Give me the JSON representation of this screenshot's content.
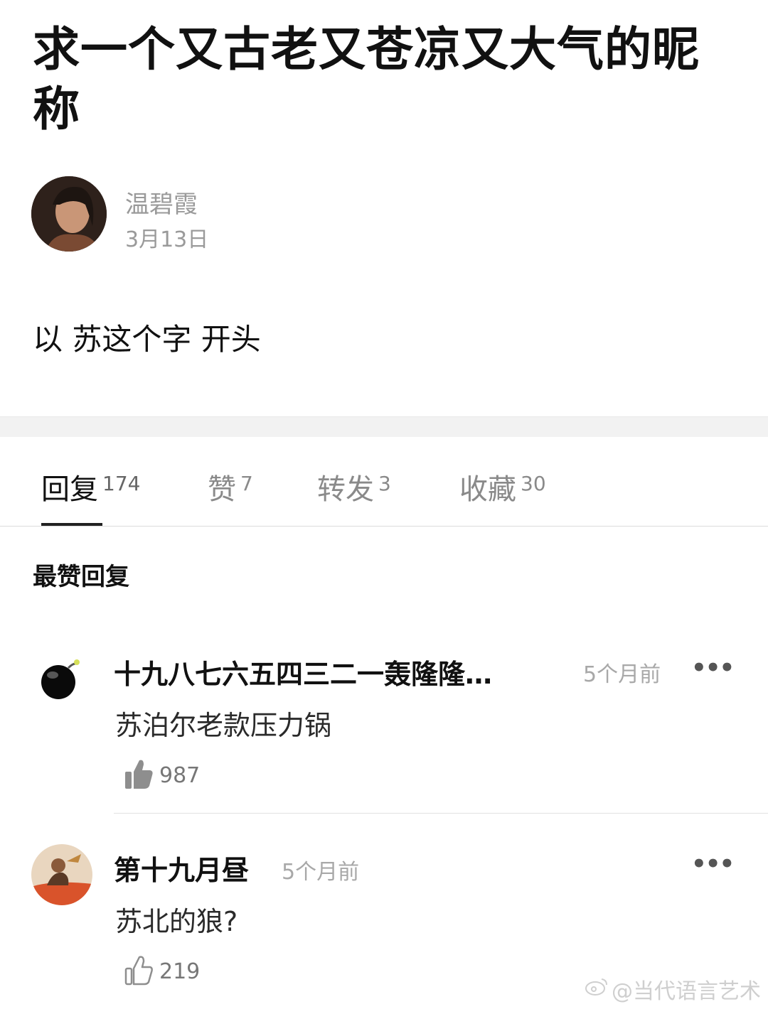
{
  "post": {
    "title": "求一个又古老又苍凉又大气的昵称",
    "author": "温碧霞",
    "date": "3月13日",
    "body": "以 苏这个字 开头"
  },
  "tabs": [
    {
      "label": "回复",
      "count": "174",
      "active": true
    },
    {
      "label": "赞",
      "count": "7",
      "active": false
    },
    {
      "label": "转发",
      "count": "3",
      "active": false
    },
    {
      "label": "收藏",
      "count": "30",
      "active": false
    }
  ],
  "section_heading": "最赞回复",
  "replies": [
    {
      "user": "十九八七六五四三二一轰隆隆…",
      "time": "5个月前",
      "text": "苏泊尔老款压力锅",
      "likes": "987",
      "like_icon": "thumbs-up-filled-icon"
    },
    {
      "user": "第十九月昼",
      "time": "5个月前",
      "text": "苏北的狼?",
      "likes": "219",
      "like_icon": "thumbs-up-outline-icon"
    }
  ],
  "more_label": "•••",
  "watermark": "@当代语言艺术",
  "colors": {
    "text_primary": "#111111",
    "text_muted": "#9a9a9a",
    "divider": "#f2f2f2"
  }
}
